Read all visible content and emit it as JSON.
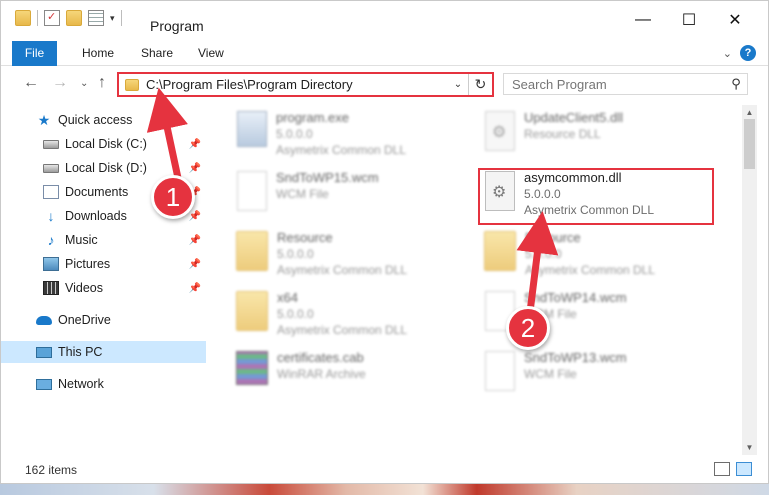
{
  "window": {
    "title": "Program",
    "controls": {
      "minimize": "—",
      "maximize": "☐",
      "close": "✕"
    }
  },
  "ribbon": {
    "tabs": [
      "File",
      "Home",
      "Share",
      "View"
    ],
    "help": "?"
  },
  "address": {
    "path": "C:\\Program Files\\Program Directory"
  },
  "search": {
    "placeholder": "Search Program"
  },
  "nav": {
    "quick_access": "Quick access",
    "items": [
      {
        "label": "Local Disk (C:)",
        "icon": "disk-icon",
        "pinned": true
      },
      {
        "label": "Local Disk (D:)",
        "icon": "disk-icon",
        "pinned": true
      },
      {
        "label": "Documents",
        "icon": "documents-icon",
        "pinned": true
      },
      {
        "label": "Downloads",
        "icon": "downloads-icon",
        "pinned": true
      },
      {
        "label": "Music",
        "icon": "music-icon",
        "pinned": true
      },
      {
        "label": "Pictures",
        "icon": "pictures-icon",
        "pinned": true
      },
      {
        "label": "Videos",
        "icon": "videos-icon",
        "pinned": true
      }
    ],
    "onedrive": "OneDrive",
    "this_pc": "This PC",
    "network": "Network"
  },
  "files": [
    {
      "name": "program.exe",
      "line2": "5.0.0.0",
      "line3": "Asymetrix Common DLL",
      "icon": "exe-icon",
      "blurred": true
    },
    {
      "name": "UpdateClient5.dll",
      "line2": "Resource DLL",
      "line3": "",
      "icon": "dll-icon",
      "blurred": true
    },
    {
      "name": "SndToWP15.wcm",
      "line2": "WCM File",
      "line3": "",
      "icon": "file-icon",
      "blurred": true
    },
    {
      "name": "asymcommon.dll",
      "line2": "5.0.0.0",
      "line3": "Asymetrix Common DLL",
      "icon": "dll-icon",
      "blurred": false
    },
    {
      "name": "Resource",
      "line2": "5.0.0.0",
      "line3": "Asymetrix Common DLL",
      "icon": "folder-icon",
      "blurred": true
    },
    {
      "name": "Resource",
      "line2": "5.0.0.0",
      "line3": "Asymetrix Common DLL",
      "icon": "folder-icon",
      "blurred": true
    },
    {
      "name": "x64",
      "line2": "5.0.0.0",
      "line3": "Asymetrix Common DLL",
      "icon": "folder-icon",
      "blurred": true
    },
    {
      "name": "SndToWP14.wcm",
      "line2": "WCM File",
      "line3": "",
      "icon": "file-icon",
      "blurred": true
    },
    {
      "name": "certificates.cab",
      "line2": "WinRAR Archive",
      "line3": "",
      "icon": "rar-icon",
      "blurred": true
    },
    {
      "name": "SndToWP13.wcm",
      "line2": "WCM File",
      "line3": "",
      "icon": "file-icon",
      "blurred": true
    }
  ],
  "status": {
    "item_count": "162 items"
  },
  "callouts": {
    "step1": "1",
    "step2": "2",
    "color": "#e5333f"
  }
}
